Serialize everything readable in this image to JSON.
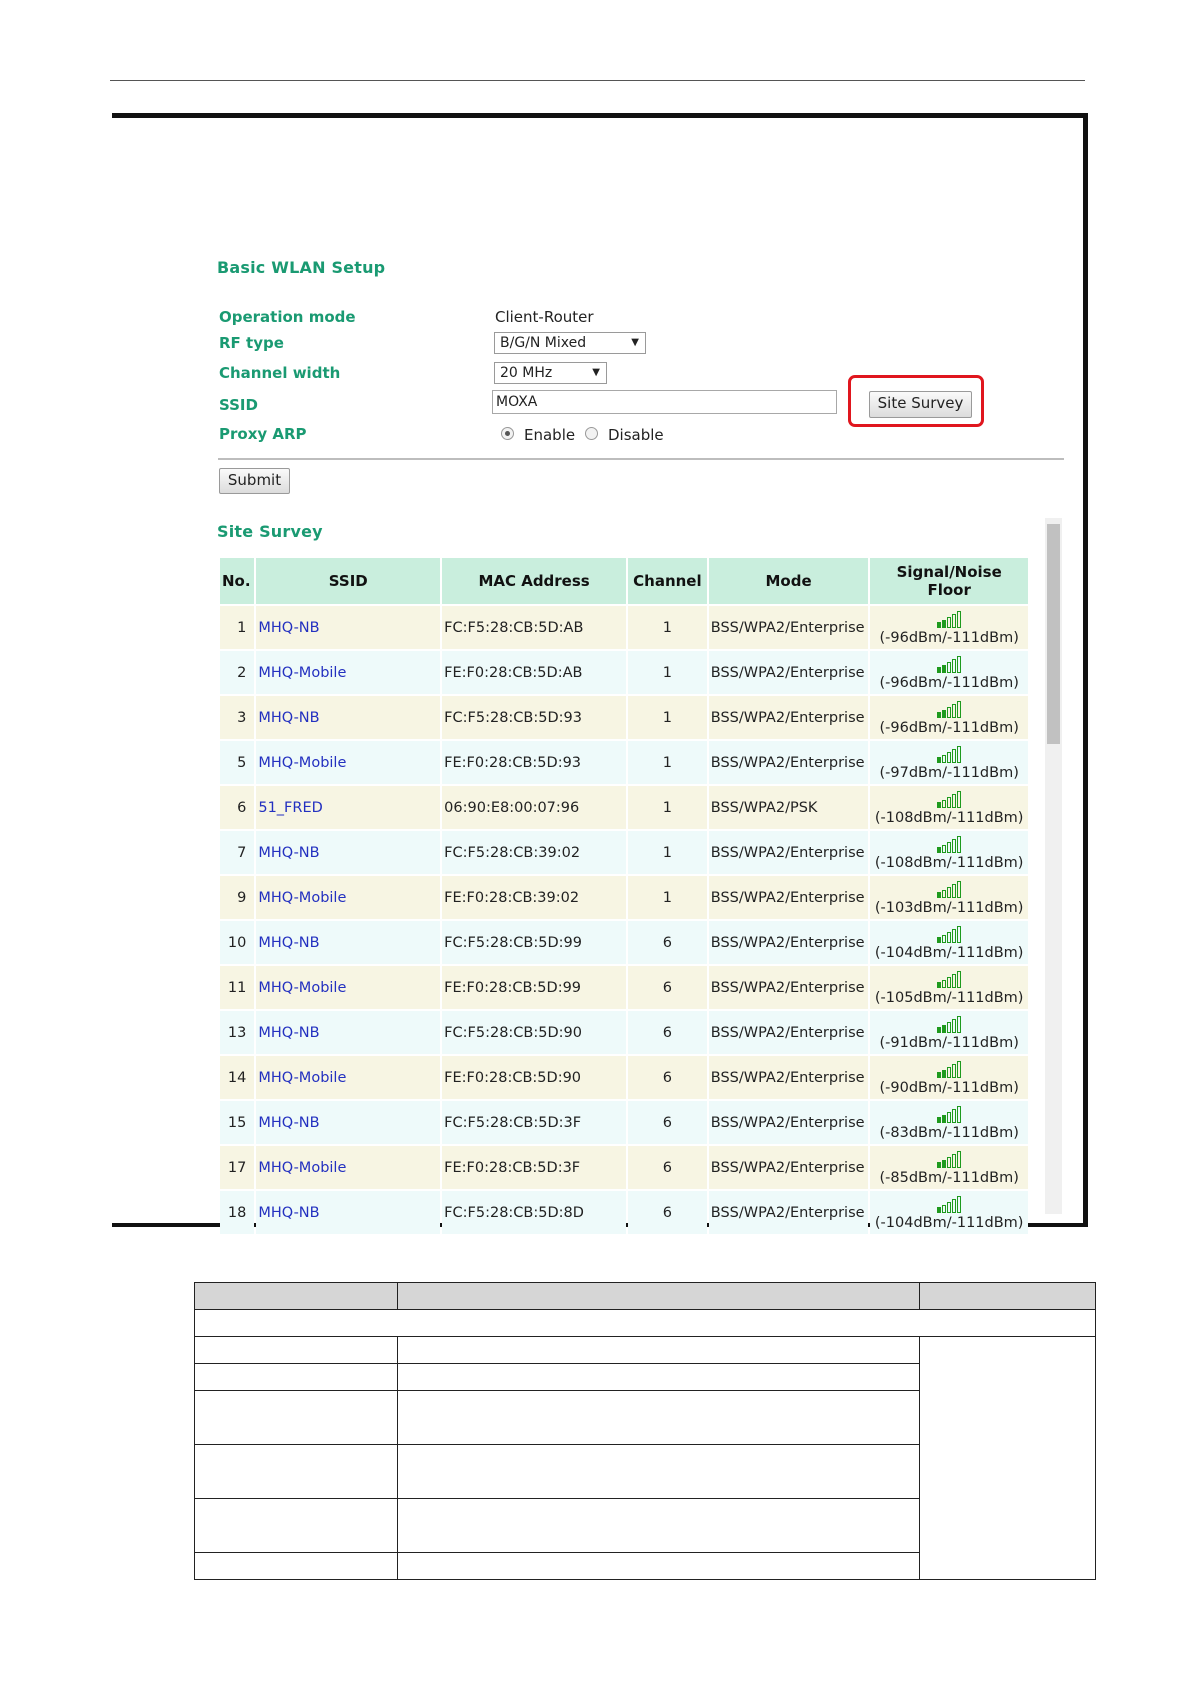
{
  "form": {
    "title": "Basic WLAN Setup",
    "operation_mode": {
      "label": "Operation mode",
      "value": "Client-Router"
    },
    "rf_type": {
      "label": "RF type",
      "value": "B/G/N Mixed"
    },
    "channel_width": {
      "label": "Channel width",
      "value": "20 MHz"
    },
    "ssid": {
      "label": "SSID",
      "value": "MOXA"
    },
    "proxy_arp": {
      "label": "Proxy ARP",
      "enable_label": "Enable",
      "disable_label": "Disable",
      "selected": "Enable"
    },
    "site_survey_button": "Site Survey",
    "submit_button": "Submit"
  },
  "survey": {
    "title": "Site Survey",
    "columns": [
      "No.",
      "SSID",
      "MAC Address",
      "Channel",
      "Mode",
      "Signal/Noise Floor"
    ],
    "rows": [
      {
        "no": "1",
        "ssid": "MHQ-NB",
        "mac": "FC:F5:28:CB:5D:AB",
        "channel": "1",
        "mode": "BSS/WPA2/Enterprise",
        "signal": "(-96dBm/-111dBm)",
        "bars": 2
      },
      {
        "no": "2",
        "ssid": "MHQ-Mobile",
        "mac": "FE:F0:28:CB:5D:AB",
        "channel": "1",
        "mode": "BSS/WPA2/Enterprise",
        "signal": "(-96dBm/-111dBm)",
        "bars": 2
      },
      {
        "no": "3",
        "ssid": "MHQ-NB",
        "mac": "FC:F5:28:CB:5D:93",
        "channel": "1",
        "mode": "BSS/WPA2/Enterprise",
        "signal": "(-96dBm/-111dBm)",
        "bars": 2
      },
      {
        "no": "5",
        "ssid": "MHQ-Mobile",
        "mac": "FE:F0:28:CB:5D:93",
        "channel": "1",
        "mode": "BSS/WPA2/Enterprise",
        "signal": "(-97dBm/-111dBm)",
        "bars": 1
      },
      {
        "no": "6",
        "ssid": "51_FRED",
        "mac": "06:90:E8:00:07:96",
        "channel": "1",
        "mode": "BSS/WPA2/PSK",
        "signal": "(-108dBm/-111dBm)",
        "bars": 1
      },
      {
        "no": "7",
        "ssid": "MHQ-NB",
        "mac": "FC:F5:28:CB:39:02",
        "channel": "1",
        "mode": "BSS/WPA2/Enterprise",
        "signal": "(-108dBm/-111dBm)",
        "bars": 1
      },
      {
        "no": "9",
        "ssid": "MHQ-Mobile",
        "mac": "FE:F0:28:CB:39:02",
        "channel": "1",
        "mode": "BSS/WPA2/Enterprise",
        "signal": "(-103dBm/-111dBm)",
        "bars": 1
      },
      {
        "no": "10",
        "ssid": "MHQ-NB",
        "mac": "FC:F5:28:CB:5D:99",
        "channel": "6",
        "mode": "BSS/WPA2/Enterprise",
        "signal": "(-104dBm/-111dBm)",
        "bars": 1
      },
      {
        "no": "11",
        "ssid": "MHQ-Mobile",
        "mac": "FE:F0:28:CB:5D:99",
        "channel": "6",
        "mode": "BSS/WPA2/Enterprise",
        "signal": "(-105dBm/-111dBm)",
        "bars": 1
      },
      {
        "no": "13",
        "ssid": "MHQ-NB",
        "mac": "FC:F5:28:CB:5D:90",
        "channel": "6",
        "mode": "BSS/WPA2/Enterprise",
        "signal": "(-91dBm/-111dBm)",
        "bars": 2
      },
      {
        "no": "14",
        "ssid": "MHQ-Mobile",
        "mac": "FE:F0:28:CB:5D:90",
        "channel": "6",
        "mode": "BSS/WPA2/Enterprise",
        "signal": "(-90dBm/-111dBm)",
        "bars": 2
      },
      {
        "no": "15",
        "ssid": "MHQ-NB",
        "mac": "FC:F5:28:CB:5D:3F",
        "channel": "6",
        "mode": "BSS/WPA2/Enterprise",
        "signal": "(-83dBm/-111dBm)",
        "bars": 2
      },
      {
        "no": "17",
        "ssid": "MHQ-Mobile",
        "mac": "FE:F0:28:CB:5D:3F",
        "channel": "6",
        "mode": "BSS/WPA2/Enterprise",
        "signal": "(-85dBm/-111dBm)",
        "bars": 2
      },
      {
        "no": "18",
        "ssid": "MHQ-NB",
        "mac": "FC:F5:28:CB:5D:8D",
        "channel": "6",
        "mode": "BSS/WPA2/Enterprise",
        "signal": "(-104dBm/-111dBm)",
        "bars": 1
      }
    ]
  },
  "colors": {
    "accent_green": "#1a9a72",
    "header_bg": "#c9eedd",
    "ssid_link": "#2330c0",
    "highlight_red": "#e0161e",
    "signal_green": "#1e9a1e"
  }
}
